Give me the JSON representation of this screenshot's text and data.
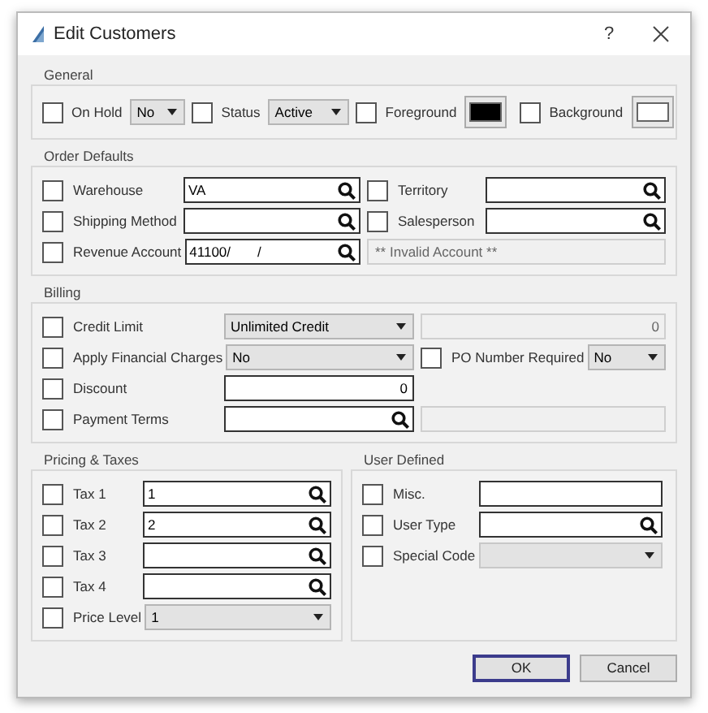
{
  "window": {
    "title": "Edit Customers",
    "help": "?"
  },
  "general": {
    "title": "General",
    "items": [
      {
        "label": "On Hold",
        "checked": false,
        "field": {
          "kind": "select",
          "value": "No"
        }
      },
      {
        "label": "Status",
        "checked": false,
        "field": {
          "kind": "select",
          "value": "Active"
        }
      },
      {
        "label": "Foreground",
        "checked": false,
        "field": {
          "kind": "swatch",
          "color": "#000000"
        }
      },
      {
        "label": "Background",
        "checked": false,
        "field": {
          "kind": "swatch",
          "color": "#ffffff"
        }
      }
    ]
  },
  "order_defaults": {
    "title": "Order Defaults",
    "rows": [
      [
        {
          "label": "Warehouse",
          "checked": false,
          "field": {
            "kind": "lookup",
            "value": "VA"
          }
        },
        {
          "label": "Territory",
          "checked": false,
          "field": {
            "kind": "lookup"
          }
        }
      ],
      [
        {
          "label": "Shipping Method",
          "checked": false,
          "field": {
            "kind": "lookup"
          }
        },
        {
          "label": "Salesperson",
          "checked": false,
          "field": {
            "kind": "lookup"
          }
        }
      ],
      [
        {
          "label": "Revenue Account",
          "checked": false,
          "field": {
            "kind": "lookup",
            "value": "41100/       /"
          }
        },
        {
          "field": {
            "kind": "readout",
            "value": "** Invalid Account **"
          }
        }
      ]
    ]
  },
  "billing": {
    "title": "Billing",
    "rows": [
      [
        {
          "label": "Credit Limit",
          "checked": false,
          "field": {
            "kind": "select",
            "value": "Unlimited Credit"
          }
        },
        {
          "field": {
            "kind": "amount_readout",
            "value": "0"
          }
        }
      ],
      [
        {
          "label": "Apply Financial Charges",
          "checked": false,
          "field": {
            "kind": "select",
            "value": "No"
          }
        },
        {
          "label": "PO Number Required",
          "checked": false,
          "field": {
            "kind": "select",
            "value": "No"
          }
        }
      ],
      [
        {
          "label": "Discount",
          "checked": false,
          "field": {
            "kind": "amount",
            "value": "0"
          }
        }
      ],
      [
        {
          "label": "Payment Terms",
          "checked": false,
          "field": {
            "kind": "lookup"
          }
        },
        {
          "field": {
            "kind": "readout"
          }
        }
      ]
    ]
  },
  "pricing_taxes": {
    "title": "Pricing & Taxes",
    "rows": [
      [
        {
          "label": "Tax 1",
          "checked": false,
          "field": {
            "kind": "lookup",
            "value": "1"
          }
        }
      ],
      [
        {
          "label": "Tax 2",
          "checked": false,
          "field": {
            "kind": "lookup",
            "value": "2"
          }
        }
      ],
      [
        {
          "label": "Tax 3",
          "checked": false,
          "field": {
            "kind": "lookup"
          }
        }
      ],
      [
        {
          "label": "Tax 4",
          "checked": false,
          "field": {
            "kind": "lookup"
          }
        }
      ],
      [
        {
          "label": "Price Level",
          "checked": false,
          "field": {
            "kind": "select",
            "value": "1"
          }
        }
      ]
    ]
  },
  "user_defined": {
    "title": "User Defined",
    "rows": [
      [
        {
          "label": "Misc.",
          "checked": false,
          "field": {
            "kind": "text"
          }
        }
      ],
      [
        {
          "label": "User Type",
          "checked": false,
          "field": {
            "kind": "lookup"
          }
        }
      ],
      [
        {
          "label": "Special Code",
          "checked": false,
          "field": {
            "kind": "disabled_select"
          }
        }
      ]
    ]
  },
  "buttons": [
    {
      "label": "OK",
      "focused": true
    },
    {
      "label": "Cancel",
      "focused": false
    }
  ]
}
